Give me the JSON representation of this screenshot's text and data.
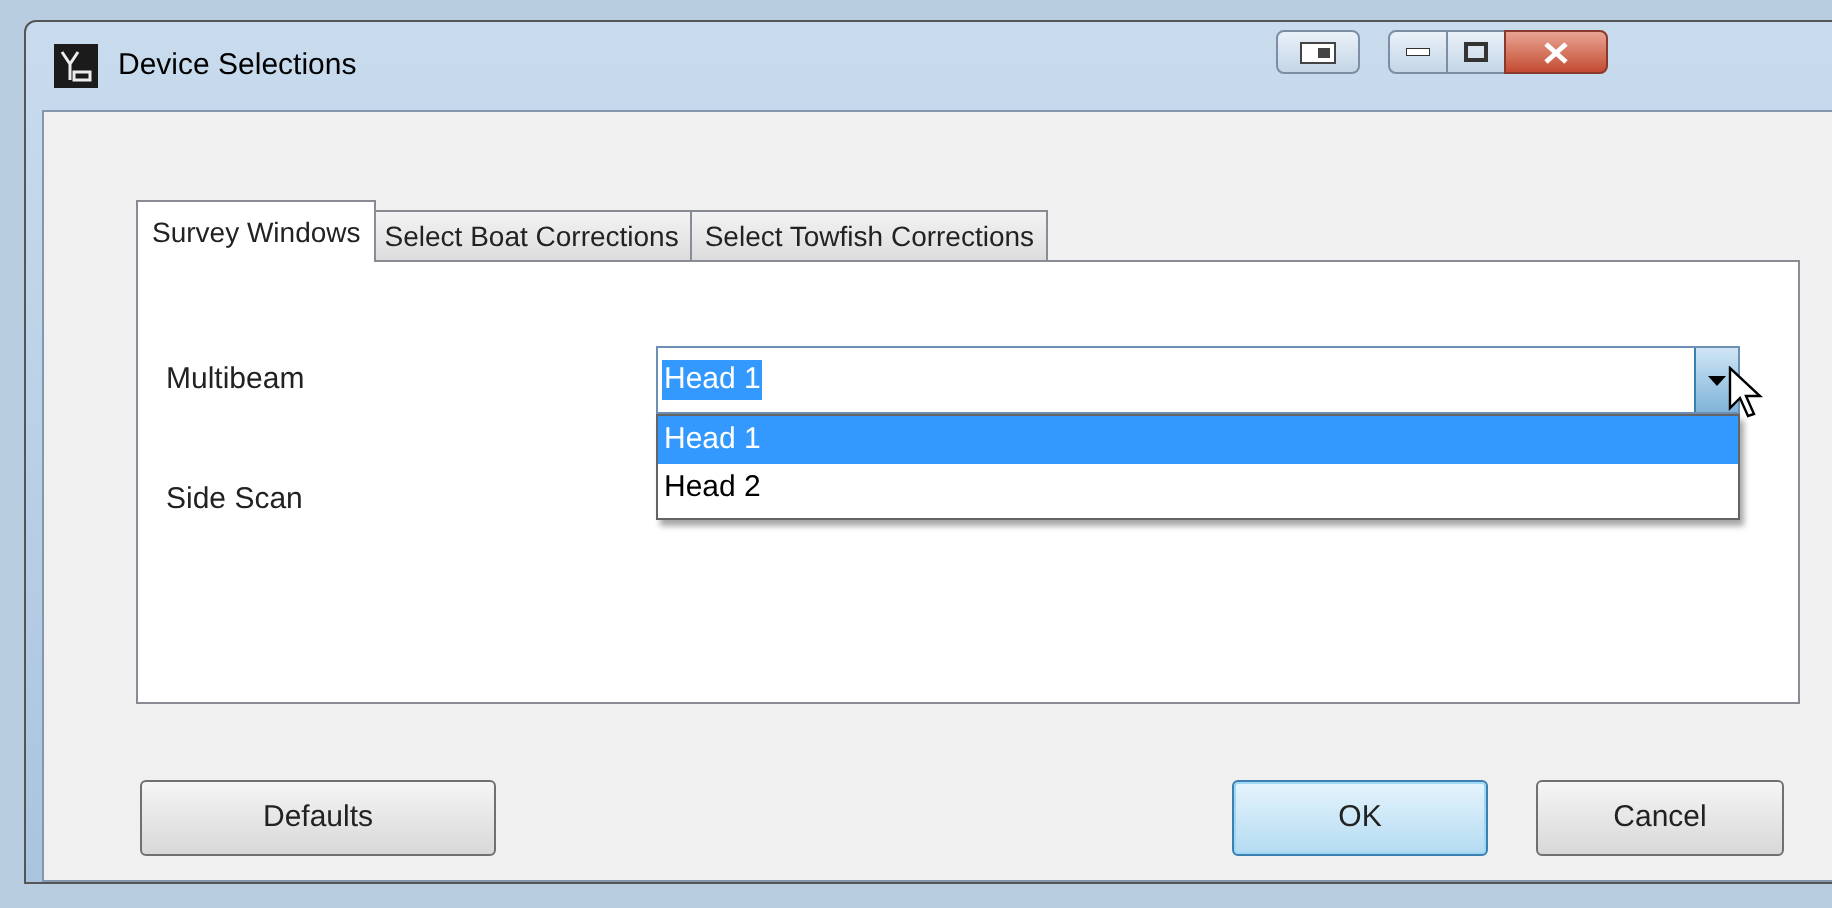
{
  "window": {
    "title": "Device Selections"
  },
  "tabs": [
    {
      "label": "Survey Windows",
      "selected": true
    },
    {
      "label": "Select Boat Corrections",
      "selected": false
    },
    {
      "label": "Select Towfish Corrections",
      "selected": false
    }
  ],
  "fields": [
    {
      "label": "Multibeam",
      "value": "Head 1",
      "expanded": true,
      "options": [
        {
          "label": "Head 1",
          "selected": true
        },
        {
          "label": "Head 2",
          "selected": false
        }
      ]
    },
    {
      "label": "Side Scan"
    }
  ],
  "buttons": [
    {
      "label": "Defaults",
      "default": false
    },
    {
      "label": "OK",
      "default": true
    },
    {
      "label": "Cancel",
      "default": false
    }
  ]
}
